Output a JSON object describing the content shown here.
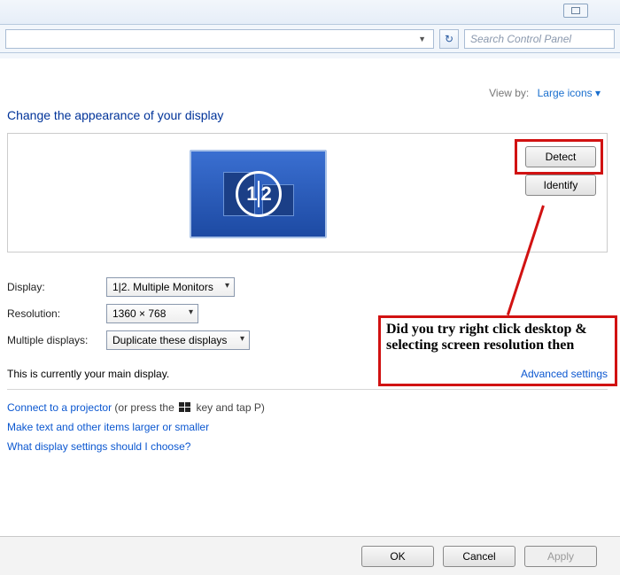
{
  "titlebar": {},
  "toolbar": {
    "search_placeholder": "Search Control Panel"
  },
  "viewby": {
    "label": "View by:",
    "value": "Large icons ▾"
  },
  "heading": "Change the appearance of your display",
  "preview": {
    "detect_label": "Detect",
    "identify_label": "Identify",
    "circle_text": "1|2"
  },
  "form": {
    "display_label": "Display:",
    "display_value": "1|2. Multiple Monitors",
    "resolution_label": "Resolution:",
    "resolution_value": "1360 × 768",
    "multiple_label": "Multiple displays:",
    "multiple_value": "Duplicate these displays"
  },
  "main_display_text": "This is currently your main display.",
  "advanced_link": "Advanced settings",
  "links": {
    "projector_a": "Connect to a projector",
    "projector_b": " (or press the ",
    "projector_c": " key and tap P)",
    "larger": "Make text and other items larger or smaller",
    "choose": "What display settings should I choose?"
  },
  "footer": {
    "ok": "OK",
    "cancel": "Cancel",
    "apply": "Apply"
  },
  "annotation": "Did you try right click desktop & selecting screen resolution then"
}
